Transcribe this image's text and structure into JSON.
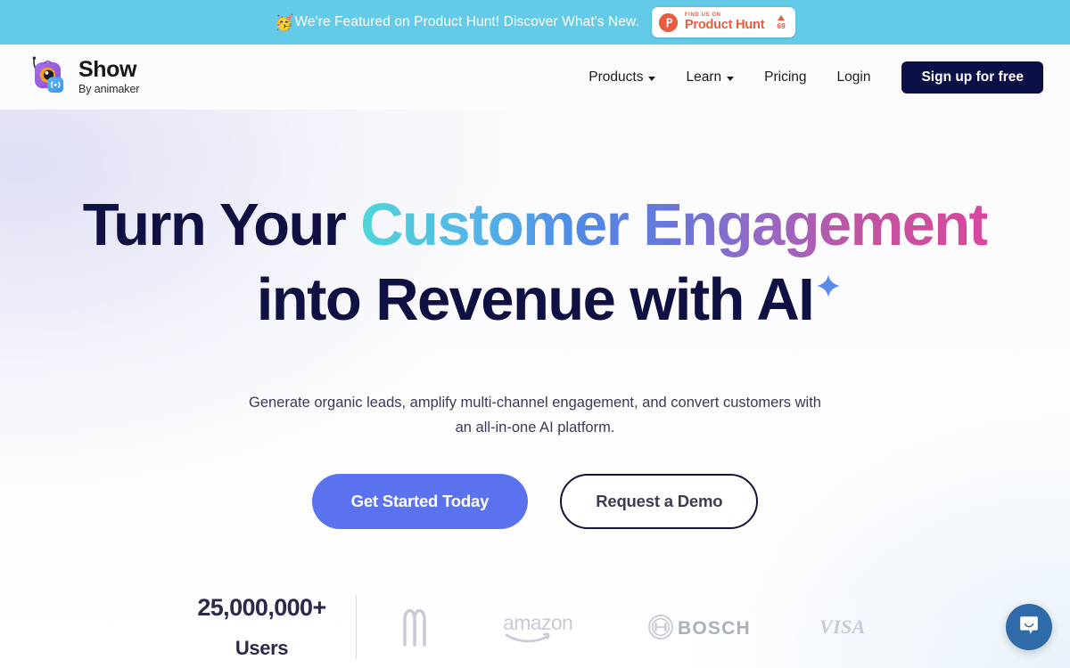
{
  "banner": {
    "emoji": "🥳",
    "text": "We're Featured on Product Hunt! Discover What's New.",
    "badge": {
      "kicker": "FIND US ON",
      "name": "Product Hunt",
      "votes": "69"
    },
    "bg_color": "#63CBE8"
  },
  "header": {
    "brand": {
      "title": "Show",
      "subtitle": "By animaker"
    },
    "nav": [
      {
        "label": "Products",
        "has_dropdown": true
      },
      {
        "label": "Learn",
        "has_dropdown": true
      },
      {
        "label": "Pricing",
        "has_dropdown": false
      },
      {
        "label": "Login",
        "has_dropdown": false
      }
    ],
    "signup_label": "Sign up for free",
    "signup_color": "#0B1147"
  },
  "hero": {
    "headline_plain_1": "Turn Your ",
    "headline_gradient": "Customer Engagement",
    "headline_line2": "into Revenue with AI",
    "subheadline_line1": "Generate organic leads, amplify multi-channel engagement, and convert customers with",
    "subheadline_line2": "an all-in-one AI platform.",
    "primary_cta": "Get Started Today",
    "secondary_cta": "Request a Demo",
    "primary_color": "#5B72EE",
    "gradient_start": "#4FD6D9",
    "gradient_end": "#D8489E",
    "headline_color": "#0E1142"
  },
  "social_proof": {
    "stat_number": "25,000,000+",
    "stat_label": "Users",
    "logos": [
      {
        "name": "mcdonalds-logo",
        "alt": "McDonald's"
      },
      {
        "name": "amazon-logo",
        "alt": "amazon"
      },
      {
        "name": "bosch-logo",
        "alt": "BOSCH"
      },
      {
        "name": "visa-logo",
        "alt": "VISA"
      }
    ],
    "logo_color": "#C6CBD4"
  },
  "chat": {
    "icon": "chat-bubble-icon",
    "color": "#2E6BA8"
  }
}
